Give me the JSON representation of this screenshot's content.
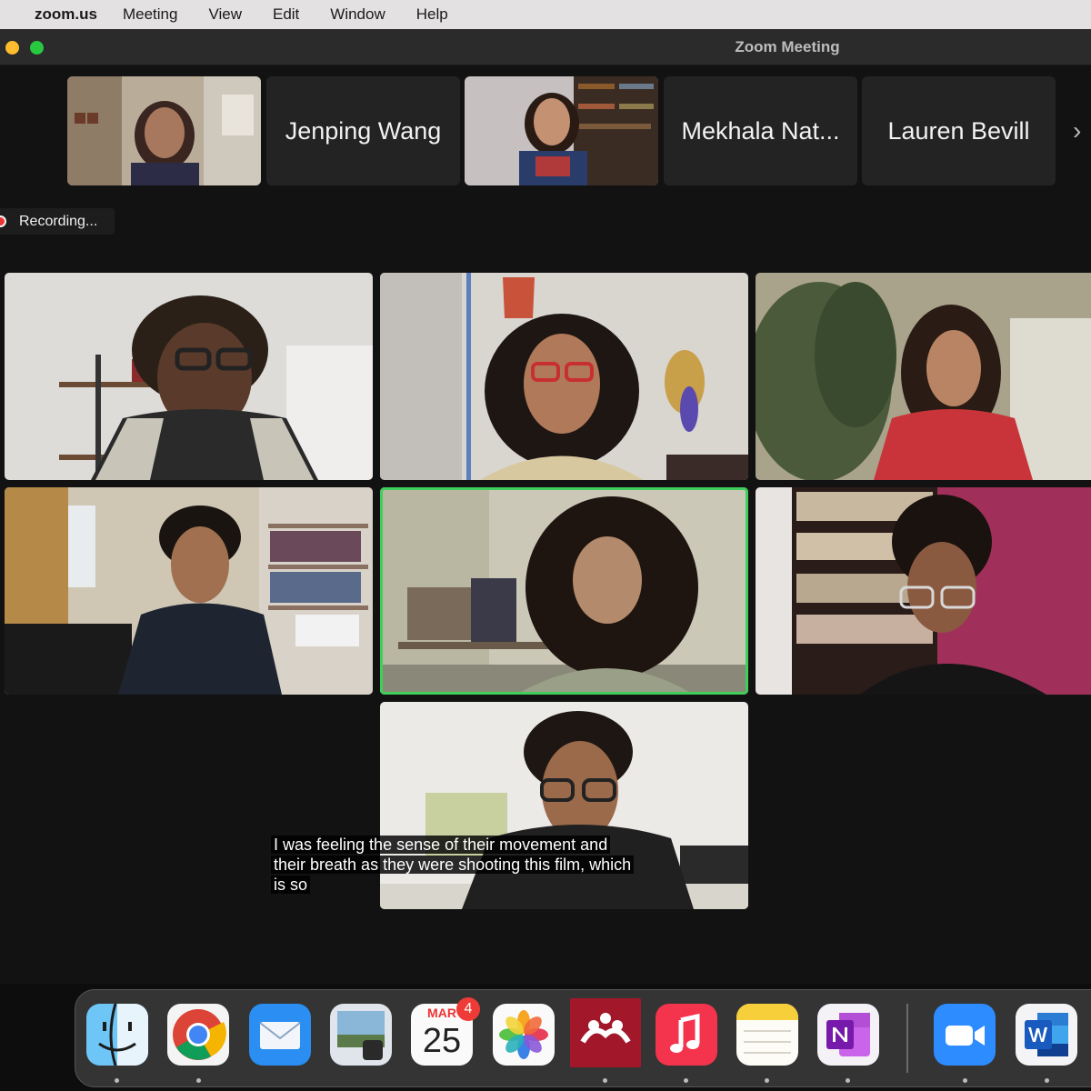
{
  "menubar": {
    "app_name": "zoom.us",
    "items": [
      "Meeting",
      "View",
      "Edit",
      "Window",
      "Help"
    ]
  },
  "window": {
    "title": "Zoom Meeting"
  },
  "filmstrip": {
    "names": [
      "Jenping Wang",
      "Mekhala Nat...",
      "Lauren Bevill"
    ]
  },
  "recording": {
    "label": "Recording..."
  },
  "caption": {
    "lines": [
      "I was feeling the sense of their movement and",
      "their breath as they were shooting this film, which",
      "is so"
    ]
  },
  "dock": {
    "calendar_month": "MAR",
    "calendar_day": "25",
    "calendar_badge": "4",
    "apps": [
      "Finder",
      "Chrome",
      "Mail",
      "Preview",
      "Calendar",
      "Photos",
      "Mendeley",
      "Music",
      "Notes",
      "OneNote",
      "Zoom",
      "Word"
    ]
  },
  "colors": {
    "active_speaker": "#3fce59",
    "recording_dot": "#e33333"
  }
}
